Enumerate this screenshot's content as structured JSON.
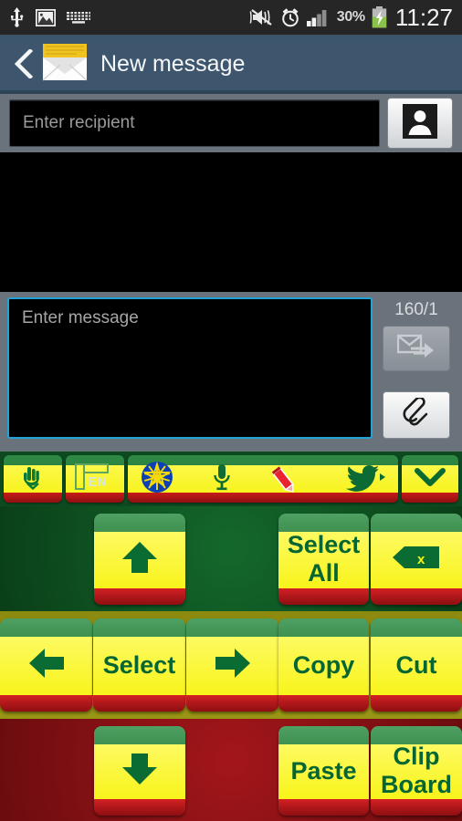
{
  "status_bar": {
    "icons_left": [
      "usb-icon",
      "image-icon",
      "keyboard-icon"
    ],
    "icons_right": [
      "mute-vibrate-icon",
      "alarm-icon",
      "signal-icon"
    ],
    "battery_percent": "30%",
    "battery_state_icon": "battery-charging-icon",
    "clock": "11:27"
  },
  "action_bar": {
    "back_icon": "back-chevron-icon",
    "app_icon": "envelope-icon",
    "title": "New message"
  },
  "recipient": {
    "placeholder": "Enter recipient",
    "value": "",
    "contacts_button_icon": "contact-person-icon"
  },
  "compose": {
    "placeholder": "Enter message",
    "value": "",
    "counter": "160/1",
    "send_button_icon": "send-message-icon",
    "attach_button_icon": "paperclip-icon"
  },
  "keyboard": {
    "toolbar": [
      {
        "name": "handwriting-key",
        "icon": "hand-writing-icon",
        "label": ""
      },
      {
        "name": "language-key",
        "icon": "language-layout-icon",
        "label": "EN"
      },
      {
        "name": "suggestion-strip",
        "icons": [
          "ethiopia-star-icon",
          "microphone-icon",
          "pencil-edit-icon",
          "twitter-bird-icon",
          "expand-arrow-icon"
        ],
        "label": ""
      },
      {
        "name": "hide-keyboard-key",
        "icon": "chevron-down-icon",
        "label": ""
      }
    ],
    "rows": [
      {
        "name": "row-1",
        "keys": [
          {
            "name": "cursor-up-key",
            "label": "",
            "icon": "arrow-up-icon"
          },
          {
            "name": "select-all-key",
            "label": "Select\nAll",
            "line1": "Select",
            "line2": "All",
            "icon": ""
          },
          {
            "name": "backspace-key",
            "label": "",
            "icon": "backspace-icon"
          }
        ]
      },
      {
        "name": "row-2",
        "keys": [
          {
            "name": "cursor-left-key",
            "label": "",
            "icon": "arrow-left-icon"
          },
          {
            "name": "select-key",
            "label": "Select",
            "icon": ""
          },
          {
            "name": "cursor-right-key",
            "label": "",
            "icon": "arrow-right-icon"
          },
          {
            "name": "copy-key",
            "label": "Copy",
            "icon": ""
          },
          {
            "name": "cut-key",
            "label": "Cut",
            "icon": ""
          }
        ]
      },
      {
        "name": "row-3",
        "keys": [
          {
            "name": "cursor-down-key",
            "label": "",
            "icon": "arrow-down-icon"
          },
          {
            "name": "paste-key",
            "label": "Paste",
            "icon": ""
          },
          {
            "name": "clipboard-key",
            "label": "Clip\nBoard",
            "line1": "Clip",
            "line2": "Board",
            "icon": ""
          }
        ]
      }
    ]
  },
  "colors": {
    "status_bar_bg": "#262626",
    "action_bar_bg": "#3d566d",
    "panel_bg": "#6a737c",
    "field_bg": "#000000",
    "focus_border": "#21a3d8",
    "key_green": "#3e9150",
    "key_yellow": "#f8f41b",
    "key_red": "#c81b1b",
    "key_text": "#056633"
  }
}
